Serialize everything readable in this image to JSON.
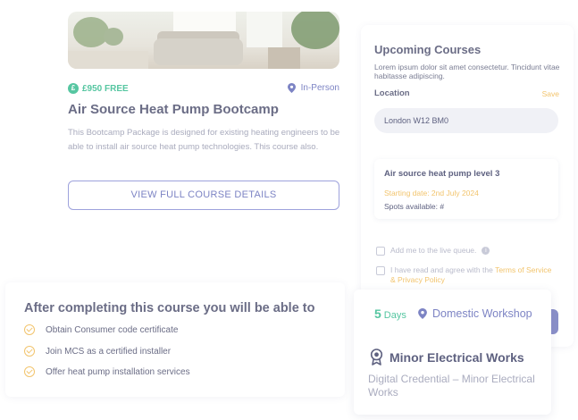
{
  "course": {
    "price": "£950 FREE",
    "delivery": "In-Person",
    "title": "Air Source Heat Pump Bootcamp",
    "description": "This Bootcamp Package is designed for existing heating engineers to be able to install air source heat pump technologies. This course also.",
    "details_button": "VIEW FULL COURSE DETAILS"
  },
  "booking": {
    "title": "Upcoming Courses",
    "intro": "Lorem ipsum dolor sit amet consectetur. Tincidunt vitae habitasse adipiscing.",
    "location_label": "Location",
    "save_label": "Save",
    "location_value": "London W12 BM0",
    "session": {
      "name": "Air source heat pump level 3",
      "start": "Starting date: 2nd July 2024",
      "spots": "Spots available: #"
    },
    "queue_label": "Add me to the live queue.",
    "terms_prefix": "I have read and agree with the",
    "terms_link": "Terms of Service & Privacy Policy"
  },
  "outcomes": {
    "title": "After completing this course you will be able to",
    "items": [
      "Obtain Consumer code certificate",
      "Join MCS as a certified installer",
      "Offer heat pump installation services"
    ]
  },
  "overview": {
    "duration_number": "5",
    "duration_unit": "Days",
    "location": "Domestic Workshop",
    "credential_title": "Minor Electrical Works",
    "credential_sub": "Digital Credential – Minor Electrical Works"
  },
  "colors": {
    "accent_purple": "#7d84c4",
    "accent_green": "#56c6a1",
    "accent_gold": "#f2c46d",
    "text_dark": "#6b6d86"
  },
  "icons": [
    "pound-icon",
    "location-pin-icon",
    "info-icon",
    "check-circle-icon",
    "award-badge-icon"
  ]
}
